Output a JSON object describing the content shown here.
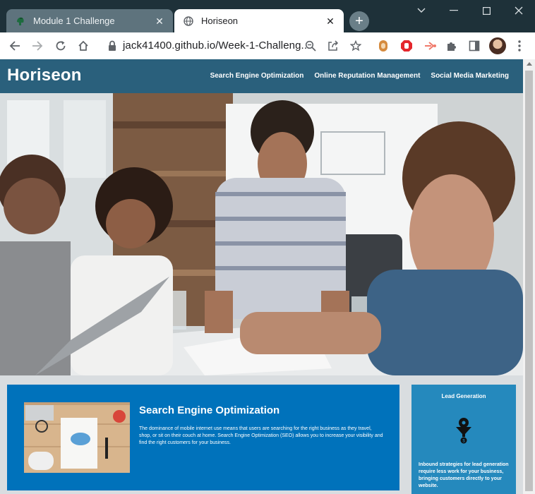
{
  "browser": {
    "tabs": [
      {
        "title": "Module 1 Challenge",
        "active": false,
        "favicon": "spartan-helmet-icon"
      },
      {
        "title": "Horiseon",
        "active": true,
        "favicon": "globe-icon"
      }
    ],
    "url": "jack41400.github.io/Week-1-Challeng...",
    "colors": {
      "tabstrip": "#1e3139",
      "inactive_tab": "#5e737d"
    }
  },
  "site": {
    "logo": "Horiseon",
    "nav": [
      "Search Engine Optimization",
      "Online Reputation Management",
      "Social Media Marketing"
    ],
    "colors": {
      "header": "#2a607c",
      "content_card": "#0072bb",
      "benefit_card": "#2589bd",
      "background": "#d9dde0"
    }
  },
  "content": {
    "seo": {
      "title": "Search Engine Optimization",
      "text": "The dominance of mobile internet use means that users are searching for the right business as they travel, shop, or sit on their couch at home. Search Engine Optimization (SEO) allows you to increase your visibility and find the right customers for your business."
    }
  },
  "benefits": {
    "lead_generation": {
      "title": "Lead Generation",
      "text": "Inbound strategies for lead generation require less work for your business, bringing customers directly to your website."
    }
  }
}
